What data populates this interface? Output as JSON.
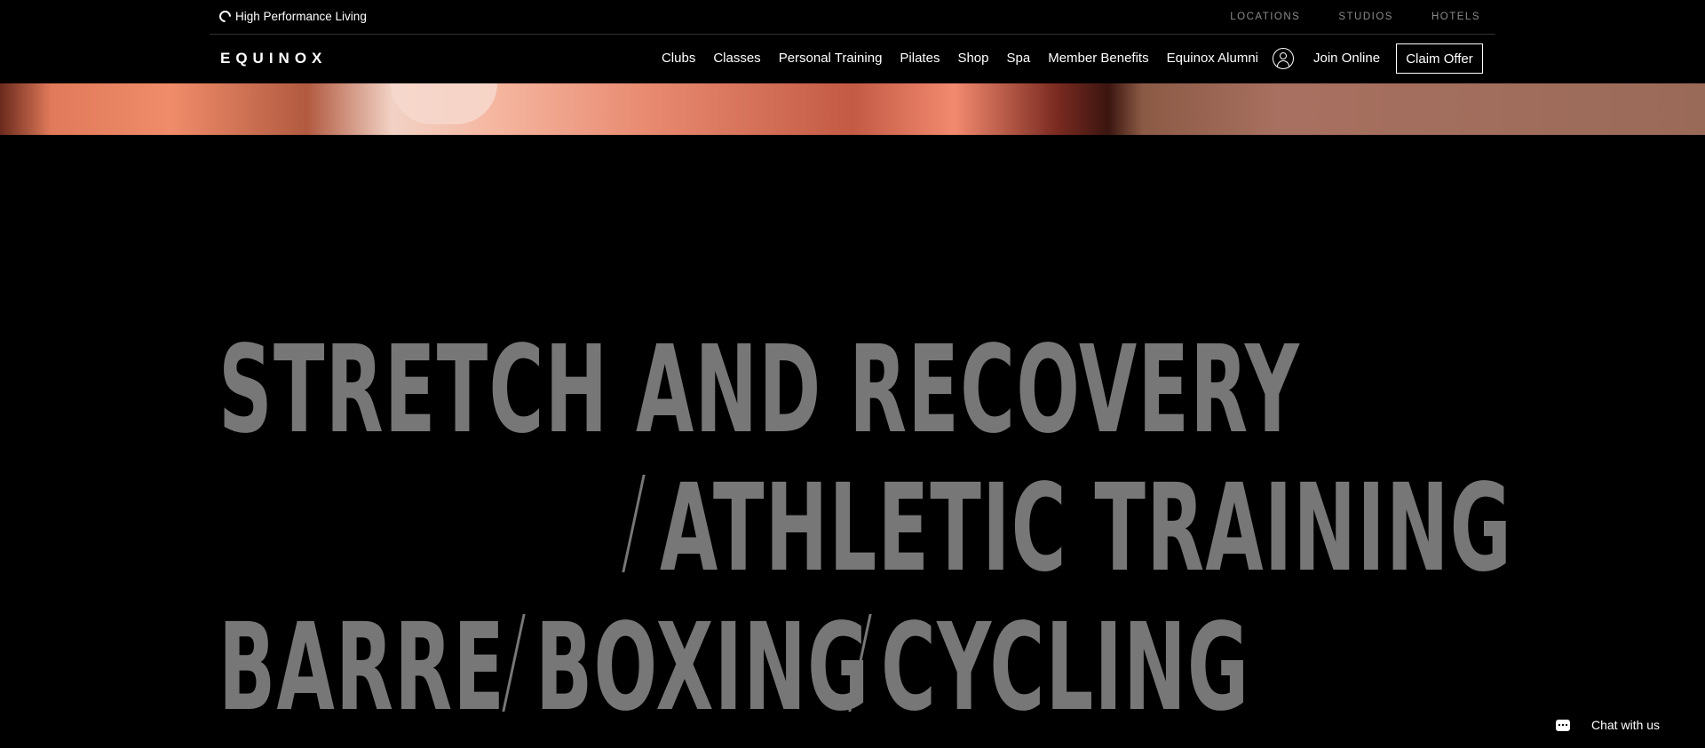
{
  "topbar": {
    "tagline": "High Performance Living",
    "util_links": [
      "LOCATIONS",
      "STUDIOS",
      "HOTELS"
    ]
  },
  "navbar": {
    "logo": "EQUINOX",
    "items": [
      "Clubs",
      "Classes",
      "Personal Training",
      "Pilates",
      "Shop",
      "Spa",
      "Member Benefits",
      "Equinox Alumni"
    ],
    "join_label": "Join Online",
    "claim_label": "Claim Offer"
  },
  "hero": {
    "line1": "STRETCH AND RECOVERY",
    "line2": "ATHLETIC TRAINING",
    "line3": [
      "BARRE",
      "BOXING",
      "CYCLING"
    ]
  },
  "chat": {
    "label": "Chat with us"
  },
  "colors": {
    "background": "#000000",
    "headline": "#777777",
    "util_link": "#8a8a8a"
  }
}
